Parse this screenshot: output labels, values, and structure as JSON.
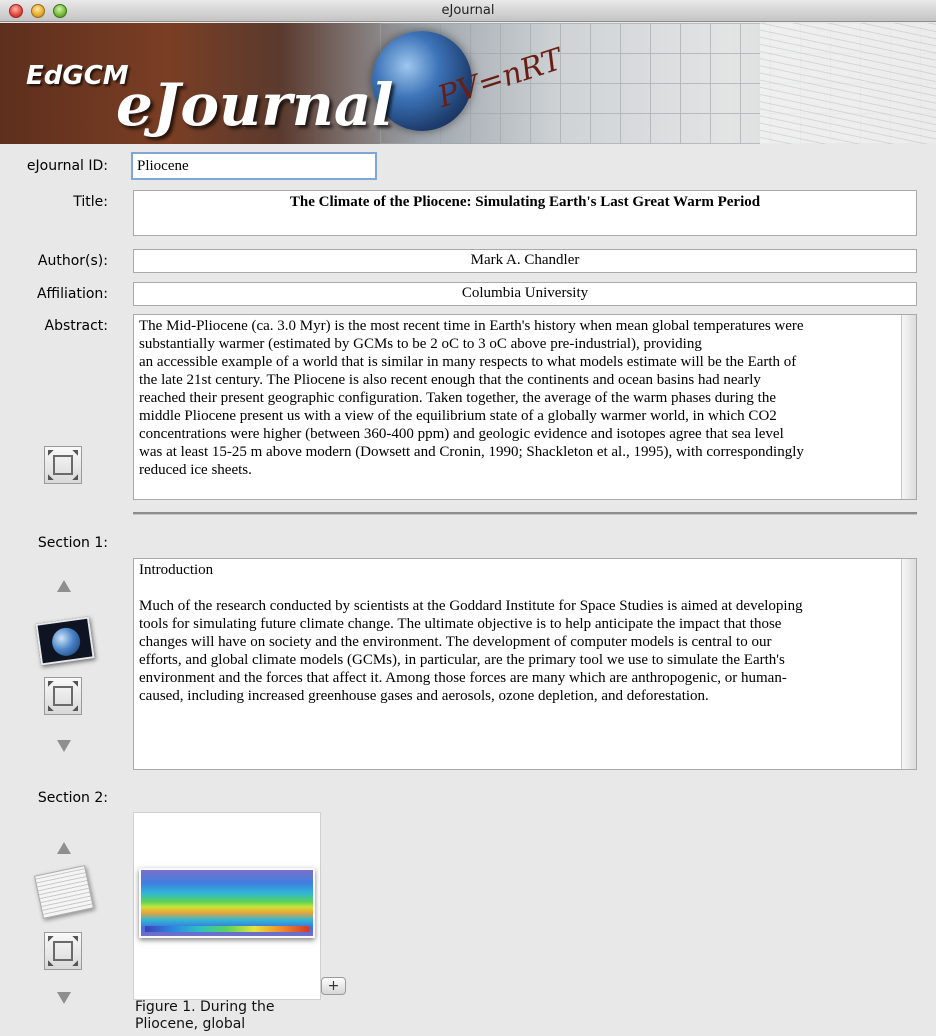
{
  "window": {
    "title": "eJournal"
  },
  "banner": {
    "brand_small": "EdGCM",
    "brand_large": "eJournal",
    "formula": "PV=nRT"
  },
  "form": {
    "id_label": "eJournal ID:",
    "id_value": "Pliocene",
    "title_label": "Title:",
    "title_value": "The Climate of the Pliocene: Simulating Earth's Last Great Warm Period",
    "author_label": "Author(s):",
    "author_value": "Mark A. Chandler",
    "affiliation_label": "Affiliation:",
    "affiliation_value": "Columbia University",
    "abstract_label": "Abstract:",
    "abstract_lines": [
      "The Mid-Pliocene (ca. 3.0 Myr) is the most recent time in Earth's history when mean global temperatures were",
      "substantially warmer (estimated by GCMs to be 2 oC to 3 oC above pre-industrial), providing",
      "an accessible example of a world that is similar in many respects to what models estimate will be the Earth of",
      "the late 21st century. The Pliocene is also recent enough that the continents and ocean basins had nearly",
      "reached their present geographic configuration. Taken together, the average of the warm phases during the",
      "middle Pliocene present us with a view of the equilibrium state of a globally warmer world, in which CO2",
      "concentrations were higher (between 360-400 ppm) and geologic evidence and isotopes agree that sea level",
      "was at least 15-25 m above modern (Dowsett and Cronin, 1990; Shackleton et al., 1995), with correspondingly",
      "reduced ice sheets."
    ]
  },
  "sections": [
    {
      "label": "Section 1:",
      "heading": "Introduction",
      "lines": [
        "Much of the research conducted by scientists at the Goddard Institute for Space Studies is aimed at developing",
        "tools for simulating future climate change. The ultimate objective is to help anticipate the impact that those",
        "changes will have on society and the environment. The development of computer models is central to our",
        "efforts, and global climate models (GCMs), in particular,  are the primary tool we use to simulate the Earth's",
        "environment and the forces that affect it. Among those forces are many which are anthropogenic, or human-",
        "caused, including increased greenhouse gases and aerosols, ozone depletion, and deforestation."
      ]
    },
    {
      "label": "Section 2:",
      "caption_lines": [
        "Figure 1. During the",
        "Pliocene, global"
      ],
      "add_label": "+"
    }
  ],
  "icons": {
    "resize": "expand-icon",
    "move_up": "arrow-up-icon",
    "move_down": "arrow-down-icon",
    "image_section": "earth-image-icon",
    "text_section": "document-icon"
  }
}
